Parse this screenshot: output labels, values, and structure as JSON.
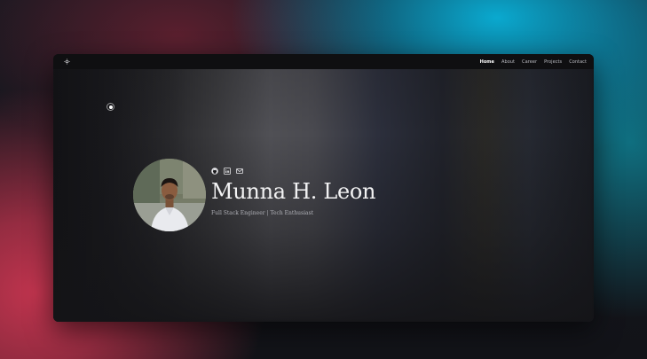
{
  "nav": {
    "theme_toggle_icon": "theme-toggle-icon",
    "links": [
      {
        "label": "Home",
        "active": true
      },
      {
        "label": "About",
        "active": false
      },
      {
        "label": "Career",
        "active": false
      },
      {
        "label": "Projects",
        "active": false
      },
      {
        "label": "Contact",
        "active": false
      }
    ]
  },
  "hero": {
    "name": "Munna H. Leon",
    "tagline": "Full Stack Engineer | Tech Enthusiast",
    "social_icons": [
      "github-icon",
      "linkedin-icon",
      "mail-icon"
    ]
  },
  "colors": {
    "background_pink": "#c0344e",
    "background_cyan": "#0aa9cf",
    "window_bg": "#141417",
    "text_primary": "#f2f2f3",
    "text_secondary": "#b0b1b7"
  }
}
